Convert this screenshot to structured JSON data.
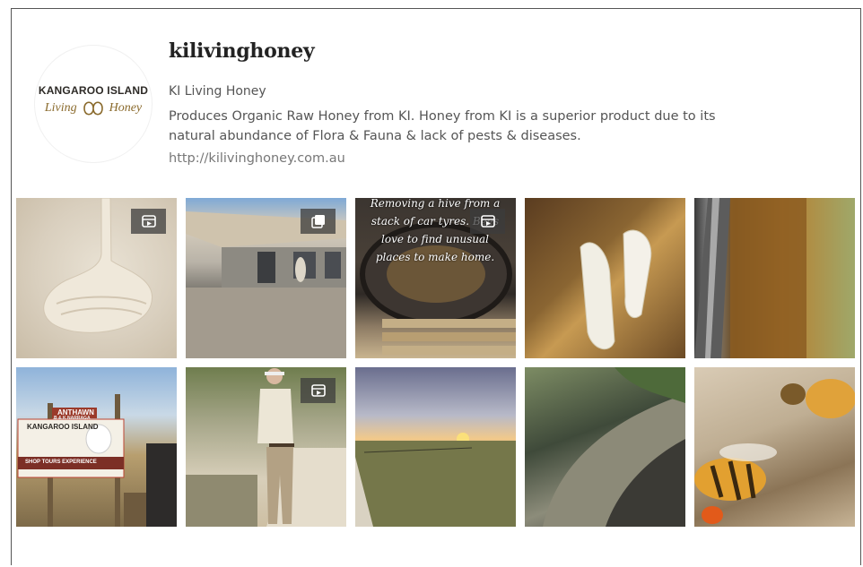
{
  "profile": {
    "username": "kilivinghoney",
    "name": "KI Living Honey",
    "bio": "Produces Organic Raw Honey from KI. Honey from KI is a superior product due to its natural abundance of Flora & Fauna & lack of pests & diseases.",
    "website": "http://kilivinghoney.com.au",
    "avatar": {
      "logo_top": "KANGAROO ISLAND",
      "logo_left": "Living",
      "logo_right": "Honey"
    }
  },
  "posts": [
    {
      "id": 1,
      "subject": "honey-drizzle",
      "badge": "reel"
    },
    {
      "id": 2,
      "subject": "shop-exterior",
      "badge": "carousel"
    },
    {
      "id": 3,
      "subject": "hive-removal-tyres",
      "badge": "reel",
      "overlay_text": "Removing a hive from a stack of car tyres. Bees love to find unusual places to make home."
    },
    {
      "id": 4,
      "subject": "bees-on-comb",
      "badge": null
    },
    {
      "id": 5,
      "subject": "bees-swarm-closeup",
      "badge": null
    },
    {
      "id": 6,
      "subject": "roadside-sign",
      "badge": null,
      "sign_top": "ANTHAWN",
      "sign_sub": "B & K NARRAGA",
      "sign_logo": "KANGAROO ISLAND",
      "sign_tours": "SHOP TOURS EXPERIENCE"
    },
    {
      "id": 7,
      "subject": "man-walking-path",
      "badge": "reel"
    },
    {
      "id": 8,
      "subject": "sunset-paddock",
      "badge": null
    },
    {
      "id": 9,
      "subject": "grass-tree-bees",
      "badge": null
    },
    {
      "id": 10,
      "subject": "honeybees-macro",
      "badge": null
    }
  ],
  "colors": {
    "username": "#222222",
    "text": "#555555",
    "link": "#777777",
    "badge_bg": "#3c3c3c"
  }
}
